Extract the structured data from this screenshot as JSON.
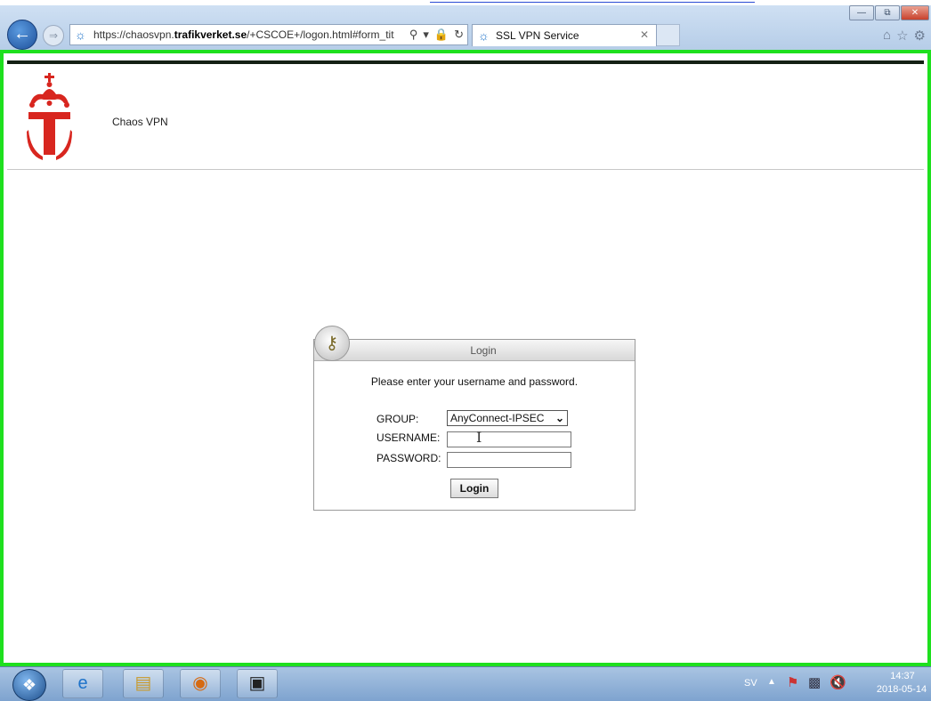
{
  "browser": {
    "url_prefix": "https://chaosvpn.",
    "url_domain": "trafikverket.se",
    "url_path": "/+CSCOE+/logon.html#form_tit",
    "tab_title": "SSL VPN Service"
  },
  "page": {
    "brand_name": "Chaos VPN"
  },
  "login": {
    "title": "Login",
    "prompt": "Please enter your username and password.",
    "group_label": "GROUP:",
    "group_value": "AnyConnect-IPSEC",
    "username_label": "USERNAME:",
    "password_label": "PASSWORD:",
    "username_value": "",
    "password_value": "",
    "button_label": "Login"
  },
  "taskbar": {
    "language": "SV",
    "time": "14:37",
    "date": "2018-05-14"
  },
  "colors": {
    "frame_border": "#1ee01e",
    "logo_red": "#d8261f"
  }
}
